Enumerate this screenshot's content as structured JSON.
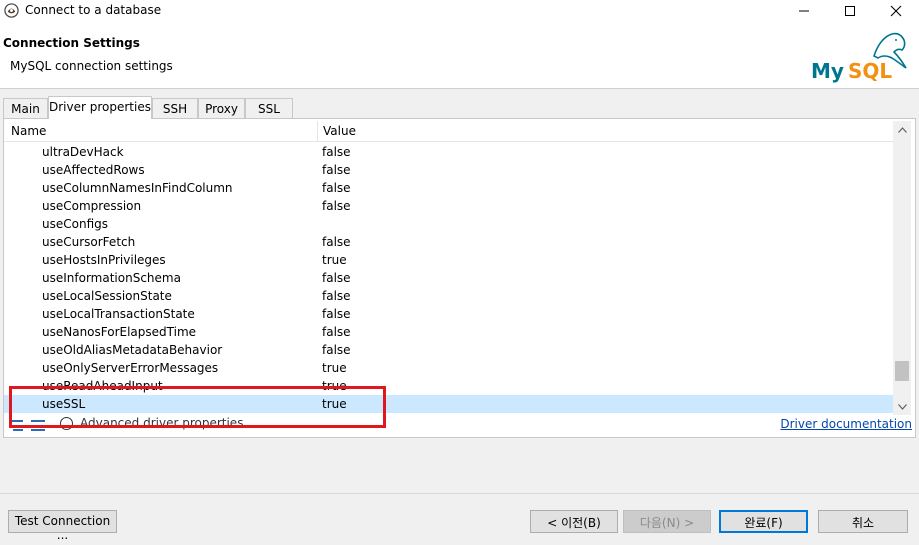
{
  "window": {
    "title": "Connect to a database"
  },
  "header": {
    "title": "Connection Settings",
    "subtitle": "MySQL connection settings",
    "logo_text": "MySQL"
  },
  "tabs": [
    {
      "label": "Main",
      "active": false
    },
    {
      "label": "Driver properties",
      "active": true
    },
    {
      "label": "SSH",
      "active": false
    },
    {
      "label": "Proxy",
      "active": false
    },
    {
      "label": "SSL",
      "active": false
    }
  ],
  "table": {
    "columns": [
      "Name",
      "Value"
    ],
    "rows": [
      {
        "name": "ultraDevHack",
        "value": "false"
      },
      {
        "name": "useAffectedRows",
        "value": "false"
      },
      {
        "name": "useColumnNamesInFindColumn",
        "value": "false"
      },
      {
        "name": "useCompression",
        "value": "false"
      },
      {
        "name": "useConfigs",
        "value": ""
      },
      {
        "name": "useCursorFetch",
        "value": "false"
      },
      {
        "name": "useHostsInPrivileges",
        "value": "true"
      },
      {
        "name": "useInformationSchema",
        "value": "false"
      },
      {
        "name": "useLocalSessionState",
        "value": "false"
      },
      {
        "name": "useLocalTransactionState",
        "value": "false"
      },
      {
        "name": "useNanosForElapsedTime",
        "value": "false"
      },
      {
        "name": "useOldAliasMetadataBehavior",
        "value": "false"
      },
      {
        "name": "useOnlyServerErrorMessages",
        "value": "true"
      },
      {
        "name": "useReadAheadInput",
        "value": "true"
      },
      {
        "name": "useSSL",
        "value": "true",
        "selected": true
      }
    ]
  },
  "footer_tools": {
    "advanced_label": "Advanced driver properties",
    "doc_link": "Driver documentation"
  },
  "buttons": {
    "test": "Test Connection ...",
    "prev": "< 이전(B)",
    "next": "다음(N) >",
    "finish": "완료(F)",
    "cancel": "취소"
  },
  "colors": {
    "selection": "#cce8ff",
    "highlight": "#e0181d",
    "link": "#0645ad",
    "mysql_blue": "#00758f",
    "mysql_orange": "#f29111"
  }
}
